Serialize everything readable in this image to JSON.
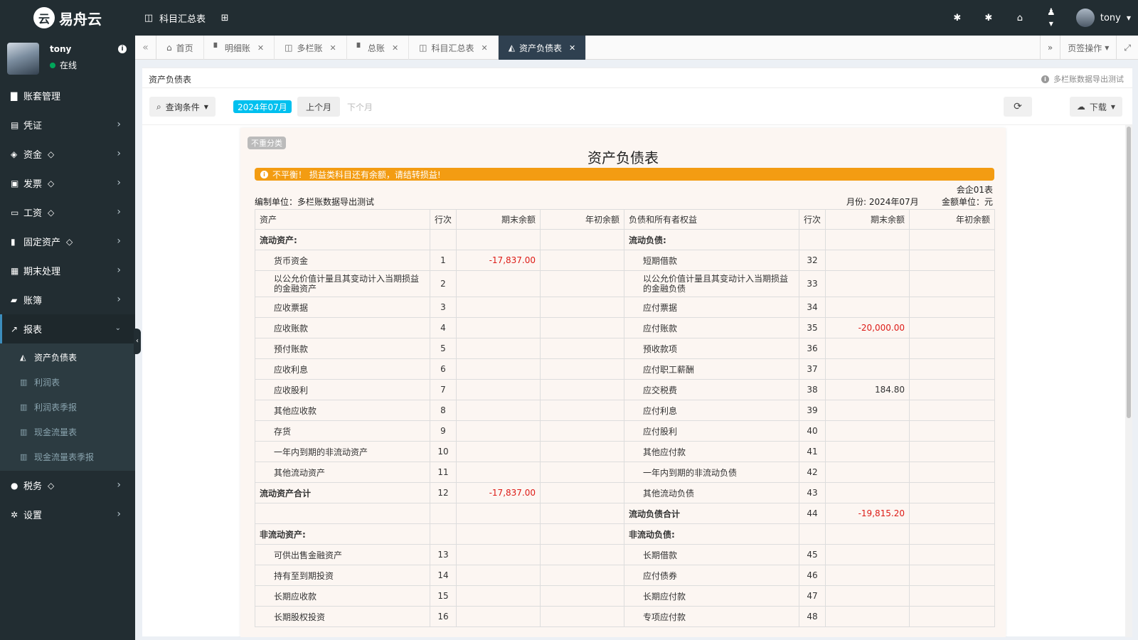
{
  "app": {
    "logo_text": "易舟云",
    "logo_glyph": "云"
  },
  "topbar": {
    "quick_link": "科目汇总表",
    "user": "tony",
    "icons": [
      "bug-icon",
      "bug-icon",
      "home-icon",
      "user-menu-icon"
    ]
  },
  "sidebar": {
    "user_name": "tony",
    "status": "在线",
    "menu": [
      {
        "label": "账套管理",
        "icon": "book-icon",
        "gem": false,
        "chevron": false
      },
      {
        "label": "凭证",
        "icon": "voucher-icon",
        "gem": false,
        "chevron": true
      },
      {
        "label": "资金",
        "icon": "money-icon",
        "gem": true,
        "chevron": true
      },
      {
        "label": "发票",
        "icon": "invoice-icon",
        "gem": true,
        "chevron": true
      },
      {
        "label": "工资",
        "icon": "card-icon",
        "gem": true,
        "chevron": true
      },
      {
        "label": "固定资产",
        "icon": "building-icon",
        "gem": true,
        "chevron": true
      },
      {
        "label": "期末处理",
        "icon": "calendar-icon",
        "gem": false,
        "chevron": true
      },
      {
        "label": "账簿",
        "icon": "ledger-icon",
        "gem": false,
        "chevron": true
      },
      {
        "label": "报表",
        "icon": "line-chart-icon",
        "gem": false,
        "chevron": true,
        "open": true
      }
    ],
    "submenu": [
      "资产负债表",
      "利润表",
      "利润表季报",
      "现金流量表",
      "现金流量表季报"
    ],
    "menu_after": [
      {
        "label": "税务",
        "icon": "tax-icon",
        "gem": true,
        "chevron": true
      },
      {
        "label": "设置",
        "icon": "gear-icon",
        "gem": false,
        "chevron": true
      }
    ]
  },
  "tabs": [
    "首页",
    "明细账",
    "多栏账",
    "总账",
    "科目汇总表",
    "资产负债表"
  ],
  "active_tab": "资产负债表",
  "tab_ops": "页签操作",
  "panel": {
    "title": "资产负债表",
    "hint": "多栏账数据导出测试",
    "query_label": "查询条件",
    "month_badge": "2024年07月",
    "prev_label": "上个月",
    "next_label": "下个月",
    "download_label": "下载"
  },
  "report": {
    "badge": "不重分类",
    "title": "资产负债表",
    "warning": "不平衡！ 损益类科目还有余额，请结转损益!",
    "form_code": "会企01表",
    "unit_label": "编制单位：多栏账数据导出测试",
    "month_label": "月份: 2024年07月",
    "currency_label": "金额单位：元",
    "headers": [
      "资产",
      "行次",
      "期末余额",
      "年初余额",
      "负债和所有者权益",
      "行次",
      "期末余额",
      "年初余额"
    ],
    "rows": [
      {
        "a": "流动资产:",
        "ab": true,
        "an": "",
        "ae": "",
        "ao": "",
        "l": "流动负债:",
        "lb": true,
        "ln": "",
        "le": "",
        "lo": ""
      },
      {
        "a": "货币资金",
        "an": "1",
        "ae": "-17,837.00",
        "ao": "",
        "l": "短期借款",
        "ln": "32",
        "le": "",
        "lo": ""
      },
      {
        "a": "以公允价值计量且其变动计入当期损益的金融资产",
        "an": "2",
        "ae": "",
        "ao": "",
        "l": "以公允价值计量且其变动计入当期损益的金融负债",
        "ln": "33",
        "le": "",
        "lo": "",
        "tall": true
      },
      {
        "a": "应收票据",
        "an": "3",
        "ae": "",
        "ao": "",
        "l": "应付票据",
        "ln": "34",
        "le": "",
        "lo": ""
      },
      {
        "a": "应收账款",
        "an": "4",
        "ae": "",
        "ao": "",
        "l": "应付账款",
        "ln": "35",
        "le": "-20,000.00",
        "lo": ""
      },
      {
        "a": "预付账款",
        "an": "5",
        "ae": "",
        "ao": "",
        "l": "预收款项",
        "ln": "36",
        "le": "",
        "lo": ""
      },
      {
        "a": "应收利息",
        "an": "6",
        "ae": "",
        "ao": "",
        "l": "应付职工薪酬",
        "ln": "37",
        "le": "",
        "lo": ""
      },
      {
        "a": "应收股利",
        "an": "7",
        "ae": "",
        "ao": "",
        "l": "应交税费",
        "ln": "38",
        "le": "184.80",
        "lo": ""
      },
      {
        "a": "其他应收款",
        "an": "8",
        "ae": "",
        "ao": "",
        "l": "应付利息",
        "ln": "39",
        "le": "",
        "lo": ""
      },
      {
        "a": "存货",
        "an": "9",
        "ae": "",
        "ao": "",
        "l": "应付股利",
        "ln": "40",
        "le": "",
        "lo": ""
      },
      {
        "a": "一年内到期的非流动资产",
        "an": "10",
        "ae": "",
        "ao": "",
        "l": "其他应付款",
        "ln": "41",
        "le": "",
        "lo": ""
      },
      {
        "a": "其他流动资产",
        "an": "11",
        "ae": "",
        "ao": "",
        "l": "一年内到期的非流动负债",
        "ln": "42",
        "le": "",
        "lo": ""
      },
      {
        "a": "流动资产合计",
        "ab": true,
        "an": "12",
        "ae": "-17,837.00",
        "ao": "",
        "l": "其他流动负债",
        "ln": "43",
        "le": "",
        "lo": ""
      },
      {
        "a": "",
        "an": "",
        "ae": "",
        "ao": "",
        "l": "流动负债合计",
        "lb": true,
        "ln": "44",
        "le": "-19,815.20",
        "lo": ""
      },
      {
        "a": "非流动资产:",
        "ab": true,
        "an": "",
        "ae": "",
        "ao": "",
        "l": "非流动负债:",
        "lb": true,
        "ln": "",
        "le": "",
        "lo": ""
      },
      {
        "a": "可供出售金融资产",
        "an": "13",
        "ae": "",
        "ao": "",
        "l": "长期借款",
        "ln": "45",
        "le": "",
        "lo": ""
      },
      {
        "a": "持有至到期投资",
        "an": "14",
        "ae": "",
        "ao": "",
        "l": "应付债券",
        "ln": "46",
        "le": "",
        "lo": ""
      },
      {
        "a": "长期应收款",
        "an": "15",
        "ae": "",
        "ao": "",
        "l": "长期应付款",
        "ln": "47",
        "le": "",
        "lo": ""
      },
      {
        "a": "长期股权投资",
        "an": "16",
        "ae": "",
        "ao": "",
        "l": "专项应付款",
        "ln": "48",
        "le": "",
        "lo": ""
      }
    ]
  }
}
